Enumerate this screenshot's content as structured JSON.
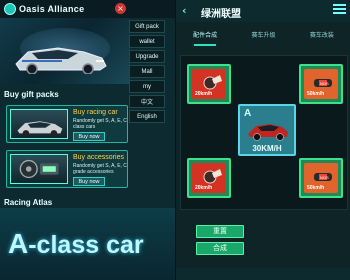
{
  "left": {
    "app_title": "Oasis Alliance",
    "close_icon": "close-icon",
    "menu": [
      "Gift pack",
      "wallet",
      "Upgrade",
      "Mall",
      "my",
      "中文",
      "English"
    ],
    "gift_section_title": "Buy gift packs",
    "packs": [
      {
        "name": "Buy racing car",
        "desc": "Randomly get S, A, E, C class cars",
        "button": "Buy now"
      },
      {
        "name": "Buy accessories",
        "desc": "Randomly get S, A, E, C grade accessories",
        "button": "Buy now"
      }
    ],
    "atlas_title": "Racing Atlas",
    "atlas_big_letter": "A",
    "atlas_big_text": "-class car"
  },
  "right": {
    "title": "绿洲联盟",
    "back_icon": "back-arrow-icon",
    "menu_icon": "menu-icon",
    "tabs": [
      "配件合成",
      "赛车升级",
      "赛车改装"
    ],
    "active_tab": 0,
    "slots": [
      {
        "label": "20km/h",
        "type": "turbo"
      },
      {
        "label": "50km/h",
        "type": "nos"
      },
      {
        "label": "20km/h",
        "type": "turbo"
      },
      {
        "label": "50km/h",
        "type": "nos"
      }
    ],
    "center_card": {
      "grade": "A",
      "speed": "30KM/H"
    },
    "buttons": {
      "reset": "重置",
      "compose": "合成"
    }
  },
  "colors": {
    "accent": "#2fe2c2",
    "slot_green": "#1f8a56",
    "slot_red": "#d43324",
    "slot_orange": "#e0642c",
    "card_teal": "#2b7e8d"
  }
}
